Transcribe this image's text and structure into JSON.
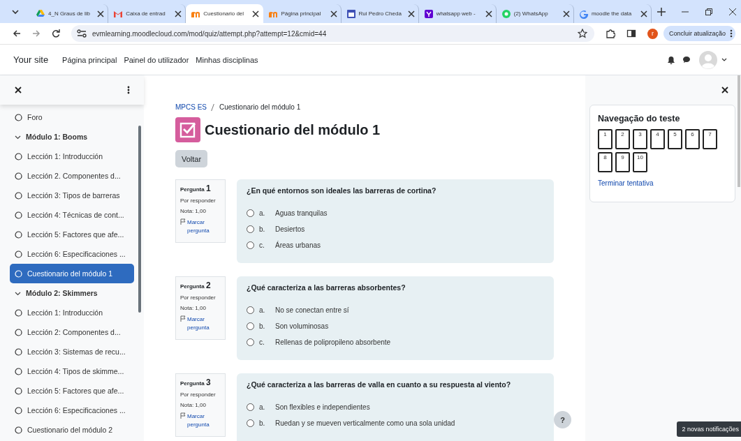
{
  "browser": {
    "tabs": [
      {
        "title": "4_N Graus de lib",
        "selected": false
      },
      {
        "title": "Caixa de entrad",
        "selected": false
      },
      {
        "title": "Cuestionario del",
        "selected": true
      },
      {
        "title": "Página principal",
        "selected": false
      },
      {
        "title": "Rui Pedro Cheda",
        "selected": false
      },
      {
        "title": "whatsapp web -",
        "selected": false
      },
      {
        "title": "(2) WhatsApp",
        "selected": false
      },
      {
        "title": "moodle the data",
        "selected": false
      }
    ],
    "url": "evmlearning.moodlecloud.com/mod/quiz/attempt.php?attempt=12&cmid=44",
    "profile_initial": "r",
    "update_button": "Concluir atualização"
  },
  "navbar": {
    "brand": "Your site",
    "links": [
      "Página principal",
      "Painel do utilizador",
      "Minhas disciplinas"
    ]
  },
  "course_index": {
    "items": [
      {
        "kind": "activity",
        "label": "Foro",
        "selected": false
      },
      {
        "kind": "section",
        "label": "Módulo 1: Booms",
        "expanded": true
      },
      {
        "kind": "activity",
        "label": "Lección 1: Introducción",
        "selected": false
      },
      {
        "kind": "activity",
        "label": "Lección 2. Componentes d...",
        "selected": false
      },
      {
        "kind": "activity",
        "label": "Lección 3: Tipos de barreras",
        "selected": false
      },
      {
        "kind": "activity",
        "label": "Lección 4: Técnicas de cont...",
        "selected": false
      },
      {
        "kind": "activity",
        "label": "Lección 5: Factores que afe...",
        "selected": false
      },
      {
        "kind": "activity",
        "label": "Lección 6: Especificaciones ...",
        "selected": false
      },
      {
        "kind": "activity",
        "label": "Cuestionario del módulo 1",
        "selected": true
      },
      {
        "kind": "section",
        "label": "Módulo 2: Skimmers",
        "expanded": true
      },
      {
        "kind": "activity",
        "label": "Lección 1: Introducción",
        "selected": false
      },
      {
        "kind": "activity",
        "label": "Lección 2: Componentes d...",
        "selected": false
      },
      {
        "kind": "activity",
        "label": "Lección 3: Sistemas de recu...",
        "selected": false
      },
      {
        "kind": "activity",
        "label": "Lección 4: Tipos de skimme...",
        "selected": false
      },
      {
        "kind": "activity",
        "label": "Lección 5: Factores que afe...",
        "selected": false
      },
      {
        "kind": "activity",
        "label": "Lección 6: Especificaciones ...",
        "selected": false
      },
      {
        "kind": "activity",
        "label": "Cuestionario del módulo 2",
        "selected": false
      }
    ]
  },
  "breadcrumb": [
    "MPCS ES",
    "Cuestionario del módulo 1"
  ],
  "title": "Cuestionario del módulo 1",
  "back_button": "Voltar",
  "questions": [
    {
      "label": "Pergunta",
      "number": "1",
      "status": "Por responder",
      "grade": "Nota: 1,00",
      "flag": "Marcar pergunta",
      "text": "¿En qué entornos son ideales las barreras de cortina?",
      "options": [
        {
          "letter": "a.",
          "text": "Aguas tranquilas",
          "selected": false
        },
        {
          "letter": "b.",
          "text": "Desiertos",
          "selected": false
        },
        {
          "letter": "c.",
          "text": "Áreas urbanas",
          "selected": false
        }
      ]
    },
    {
      "label": "Pergunta",
      "number": "2",
      "status": "Por responder",
      "grade": "Nota: 1,00",
      "flag": "Marcar pergunta",
      "text": "¿Qué caracteriza a las barreras absorbentes?",
      "options": [
        {
          "letter": "a.",
          "text": "No se conectan entre sí",
          "selected": false
        },
        {
          "letter": "b.",
          "text": "Son voluminosas",
          "selected": false
        },
        {
          "letter": "c.",
          "text": "Rellenas de polipropileno absorbente",
          "selected": false
        }
      ]
    },
    {
      "label": "Pergunta",
      "number": "3",
      "status": "Por responder",
      "grade": "Nota: 1,00",
      "flag": "Marcar pergunta",
      "text": "¿Qué caracteriza a las barreras de valla en cuanto a su respuesta al viento?",
      "options": [
        {
          "letter": "a.",
          "text": "Son flexibles e independientes",
          "selected": false
        },
        {
          "letter": "b.",
          "text": "Ruedan y se mueven verticalmente como una sola unidad",
          "selected": false
        }
      ]
    }
  ],
  "quiz_navigation": {
    "title": "Navegação do teste",
    "buttons": [
      "1",
      "2",
      "3",
      "4",
      "5",
      "6",
      "7",
      "8",
      "9",
      "10"
    ],
    "finish_link": "Terminar tentativa"
  },
  "help_button": "?",
  "toast": "2 novas notificações"
}
